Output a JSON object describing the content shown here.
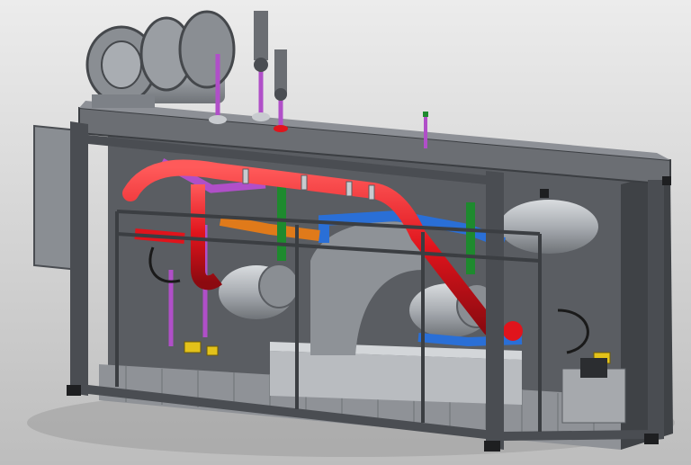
{
  "scene": {
    "subject": "cad-skid-mounted-pump-unit",
    "colors": {
      "background_top": "#ececec",
      "background_bottom": "#bdbdbd",
      "frame": "#4a4d52",
      "frame_light": "#6b6e73",
      "steel": "#a9adb2",
      "steel_dark": "#7d8187",
      "pipe_red": "#e0141c",
      "pipe_blue": "#2a6fd6",
      "pipe_green": "#1e8a2e",
      "pipe_orange": "#e07a1a",
      "pipe_purple": "#b04fc8",
      "valve_yellow": "#e3c21a",
      "grating": "#8f9297"
    }
  }
}
